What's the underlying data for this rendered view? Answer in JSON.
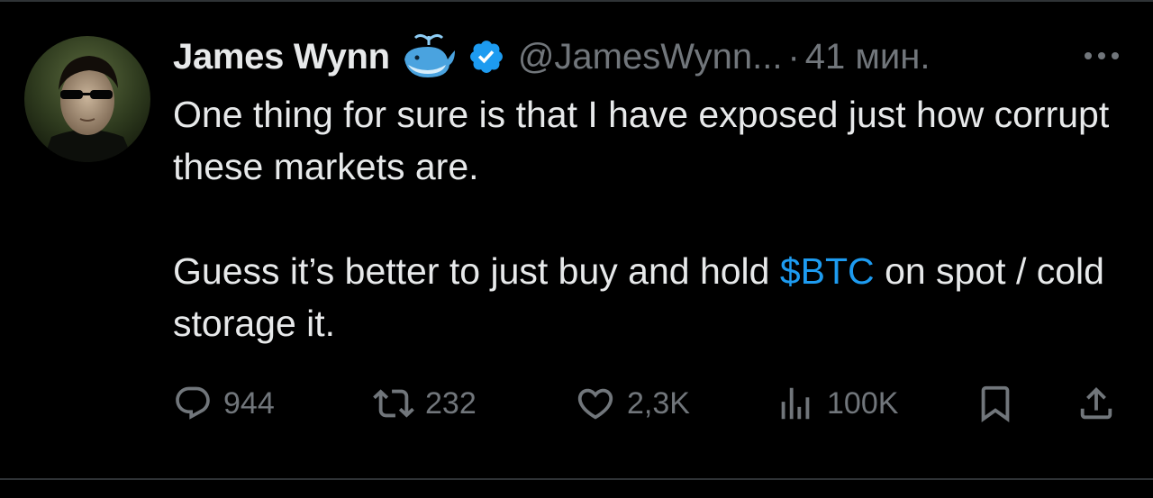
{
  "colors": {
    "background": "#000000",
    "text_primary": "#e7e9ea",
    "text_secondary": "#71767b",
    "accent": "#1d9bf0"
  },
  "tweet": {
    "author_name": "James Wynn",
    "handle": "@JamesWynn...",
    "separator": "·",
    "time": "41 мин.",
    "badges": [
      "whale-emoji-icon",
      "verified-badge-icon"
    ],
    "body": {
      "line1": "One thing for sure is that I have exposed just how corrupt these markets are.",
      "line2_before": "Guess it’s better to just buy and hold ",
      "cashtag": "$BTC",
      "line2_after": " on spot / cold storage it."
    },
    "actions": {
      "replies": "944",
      "reposts": "232",
      "likes": "2,3K",
      "views": "100K"
    },
    "icons": {
      "reply": "reply-icon",
      "repost": "repost-icon",
      "like": "heart-icon",
      "views": "views-icon",
      "bookmark": "bookmark-icon",
      "share": "share-icon",
      "more": "more-icon"
    }
  }
}
